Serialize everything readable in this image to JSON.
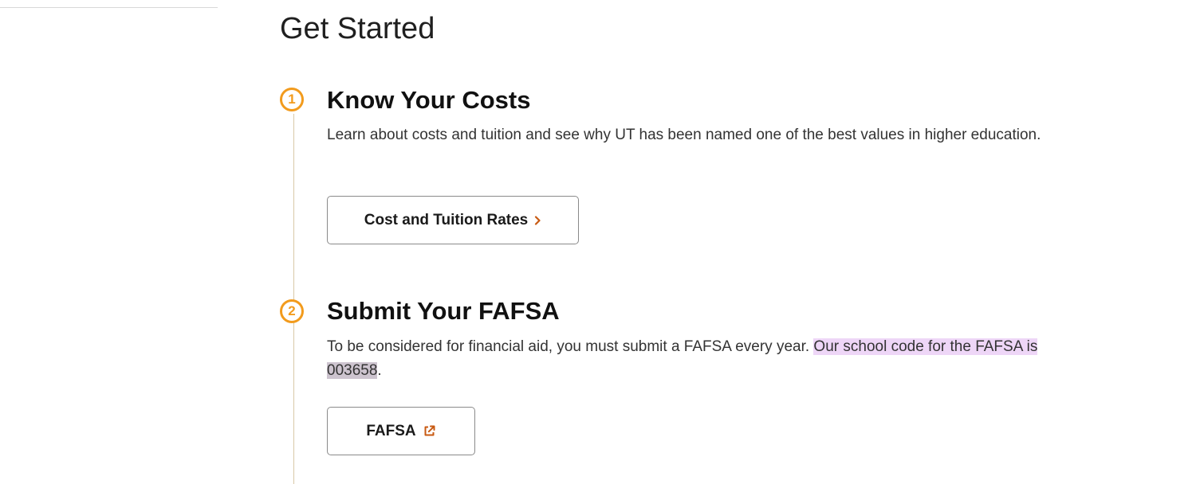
{
  "section": {
    "title": "Get Started"
  },
  "steps": [
    {
      "number": "1",
      "heading": "Know Your Costs",
      "description": "Learn about costs and tuition and see why UT has been named one of the best values in higher education.",
      "button_label": "Cost and Tuition Rates",
      "button_icon": "chevron-right-icon"
    },
    {
      "number": "2",
      "heading": "Submit Your FAFSA",
      "description_plain": "To be considered for financial aid, you must submit a FAFSA every year. ",
      "description_highlight": "Our school code for the FAFSA is ",
      "school_code": "003658",
      "description_end": ".",
      "button_label": "FAFSA",
      "button_icon": "external-link-icon"
    }
  ],
  "colors": {
    "accent": "#f29b1d",
    "highlight": "#eed6f7",
    "timeline": "#d9c9a8"
  }
}
